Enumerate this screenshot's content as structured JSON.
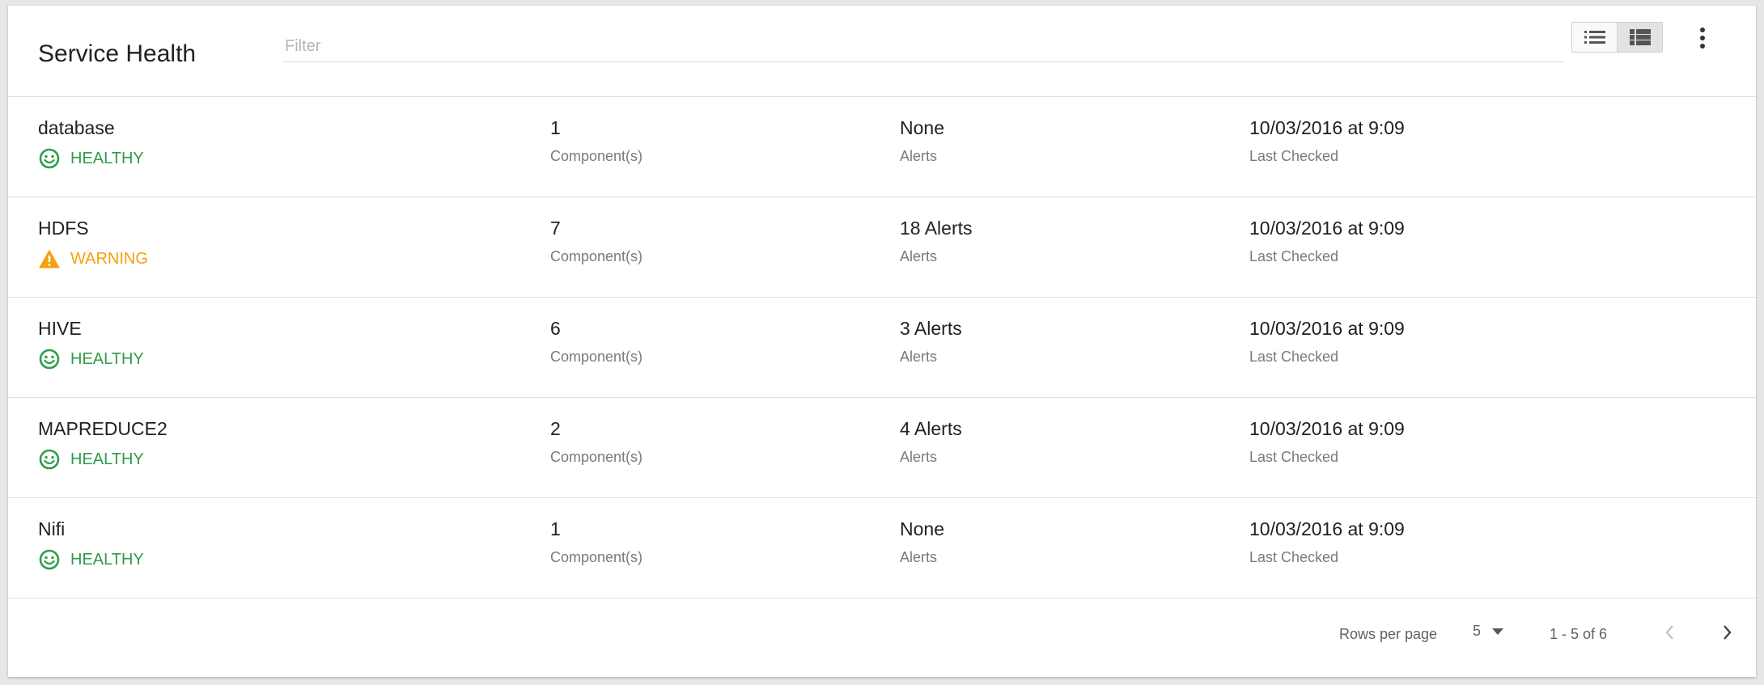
{
  "header": {
    "title": "Service Health",
    "filter_placeholder": "Filter",
    "filter_value": ""
  },
  "view_toggle": {
    "options": [
      "list-view",
      "detail-list-view"
    ],
    "active": "detail-list-view"
  },
  "colors": {
    "healthy": "#2e9d4a",
    "warning": "#f5a00e"
  },
  "services": [
    {
      "name": "database",
      "status": "HEALTHY",
      "status_icon": "smiley-icon",
      "components": "1",
      "components_label": "Component(s)",
      "alerts": "None",
      "alerts_label": "Alerts",
      "last_checked": "10/03/2016 at 9:09",
      "last_checked_label": "Last Checked"
    },
    {
      "name": "HDFS",
      "status": "WARNING",
      "status_icon": "warning-triangle-icon",
      "components": "7",
      "components_label": "Component(s)",
      "alerts": "18 Alerts",
      "alerts_label": "Alerts",
      "last_checked": "10/03/2016 at 9:09",
      "last_checked_label": "Last Checked"
    },
    {
      "name": "HIVE",
      "status": "HEALTHY",
      "status_icon": "smiley-icon",
      "components": "6",
      "components_label": "Component(s)",
      "alerts": "3 Alerts",
      "alerts_label": "Alerts",
      "last_checked": "10/03/2016 at 9:09",
      "last_checked_label": "Last Checked"
    },
    {
      "name": "MAPREDUCE2",
      "status": "HEALTHY",
      "status_icon": "smiley-icon",
      "components": "2",
      "components_label": "Component(s)",
      "alerts": "4 Alerts",
      "alerts_label": "Alerts",
      "last_checked": "10/03/2016 at 9:09",
      "last_checked_label": "Last Checked"
    },
    {
      "name": "Nifi",
      "status": "HEALTHY",
      "status_icon": "smiley-icon",
      "components": "1",
      "components_label": "Component(s)",
      "alerts": "None",
      "alerts_label": "Alerts",
      "last_checked": "10/03/2016 at 9:09",
      "last_checked_label": "Last Checked"
    }
  ],
  "footer": {
    "rows_per_page_label": "Rows per page",
    "rows_per_page_value": "5",
    "range_label": "1 - 5 of 6"
  }
}
